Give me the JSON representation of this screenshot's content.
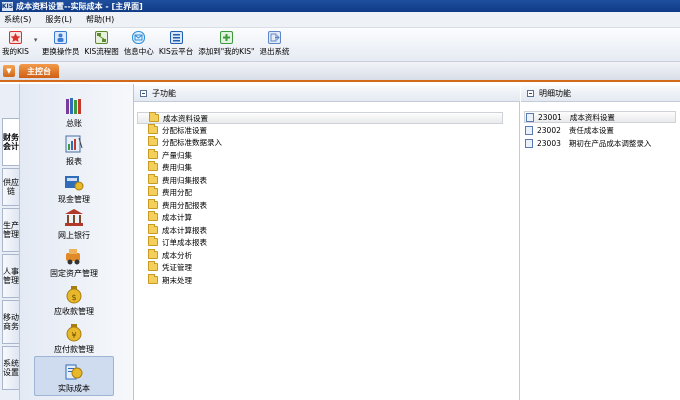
{
  "window": {
    "title": "成本资料设置--实际成本 - [主界面]",
    "logo": "KIS"
  },
  "menu": {
    "items": [
      "系统(S)",
      "服务(L)",
      "帮助(H)"
    ]
  },
  "toolbar": {
    "buttons": [
      {
        "label": "我的KIS",
        "icon": "star-icon",
        "color": "#d9302c"
      },
      {
        "label": "更换操作员",
        "icon": "user-switch-icon",
        "color": "#3b7bd4"
      },
      {
        "label": "KIS流程图",
        "icon": "flowchart-icon",
        "color": "#5c8a2e"
      },
      {
        "label": "信息中心",
        "icon": "message-center-icon",
        "color": "#2f8ed8"
      },
      {
        "label": "KIS云平台",
        "icon": "cloud-platform-icon",
        "color": "#1f5fb0"
      },
      {
        "label": "添加到\"我的KIS\"",
        "icon": "add-favorite-icon",
        "color": "#3d9b3d"
      },
      {
        "label": "退出系统",
        "icon": "exit-icon",
        "color": "#5e86c7"
      }
    ]
  },
  "tabstrip": {
    "main_tab": "主控台"
  },
  "vtabs": [
    "财务会计",
    "供应链",
    "生产管理",
    "人事管理",
    "移动商务",
    "系统设置"
  ],
  "modules": [
    {
      "label": "总账",
      "icon": "ledger-books-icon"
    },
    {
      "label": "报表",
      "icon": "report-icon"
    },
    {
      "label": "现金管理",
      "icon": "cash-icon"
    },
    {
      "label": "网上银行",
      "icon": "online-bank-icon"
    },
    {
      "label": "固定资产管理",
      "icon": "fixed-assets-icon"
    },
    {
      "label": "应收款管理",
      "icon": "receivables-icon"
    },
    {
      "label": "应付款管理",
      "icon": "payables-icon"
    },
    {
      "label": "实际成本",
      "icon": "actual-cost-icon"
    }
  ],
  "sub_panel": {
    "title": "子功能",
    "items": [
      "成本资料设置",
      "分配标准设置",
      "分配标准数据录入",
      "产量归集",
      "费用归集",
      "费用归集报表",
      "费用分配",
      "费用分配报表",
      "成本计算",
      "成本计算报表",
      "订单成本报表",
      "成本分析",
      "凭证管理",
      "期末处理"
    ]
  },
  "detail_panel": {
    "title": "明细功能",
    "items": [
      {
        "code": "23001",
        "label": "成本资料设置"
      },
      {
        "code": "23002",
        "label": "责任成本设置"
      },
      {
        "code": "23003",
        "label": "期初在产品成本调整录入"
      }
    ]
  },
  "colors": {
    "accent_orange": "#d36a1a",
    "title_blue": "#0f3a86",
    "folder_yellow": "#f4cf5c"
  }
}
